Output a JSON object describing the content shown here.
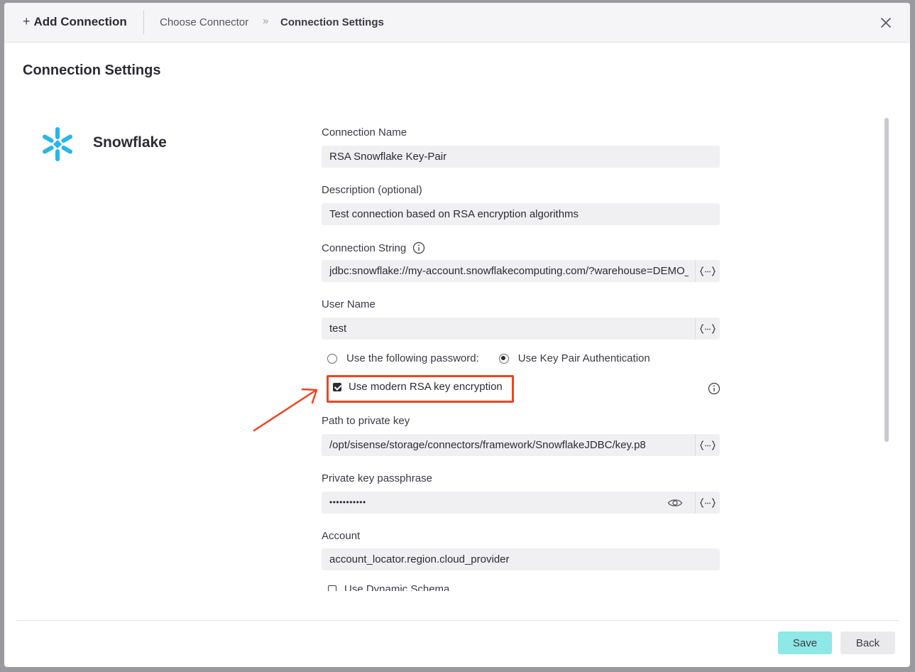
{
  "header": {
    "add_connection": "Add Connection",
    "breadcrumb": [
      "Choose Connector",
      "Connection Settings"
    ]
  },
  "page_title": "Connection Settings",
  "connector": {
    "name": "Snowflake"
  },
  "form": {
    "connection_name": {
      "label": "Connection Name",
      "value": "RSA Snowflake Key-Pair"
    },
    "description": {
      "label": "Description (optional)",
      "value": "Test connection based on RSA encryption algorithms"
    },
    "connection_string": {
      "label": "Connection String",
      "value": "jdbc:snowflake://my-account.snowflakecomputing.com/?warehouse=DEMO_"
    },
    "user_name": {
      "label": "User Name",
      "value": "test"
    },
    "auth": {
      "option_password": "Use the following password:",
      "option_keypair": "Use Key Pair Authentication",
      "selected": "keypair"
    },
    "modern_rsa": {
      "label": "Use modern RSA key encryption",
      "checked": true
    },
    "private_key_path": {
      "label": "Path to private key",
      "value": "/opt/sisense/storage/connectors/framework/SnowflakeJDBC/key.p8"
    },
    "passphrase": {
      "label": "Private key passphrase",
      "value": "•••••••••••"
    },
    "account": {
      "label": "Account",
      "value": "account_locator.region.cloud_provider"
    },
    "dynamic_schema": {
      "label": "Use Dynamic Schema",
      "checked": false
    }
  },
  "footer": {
    "save": "Save",
    "back": "Back"
  },
  "colors": {
    "save_button": "#8de8e6",
    "highlight": "#ef4423",
    "snowflake_logo": "#29b5e8"
  }
}
